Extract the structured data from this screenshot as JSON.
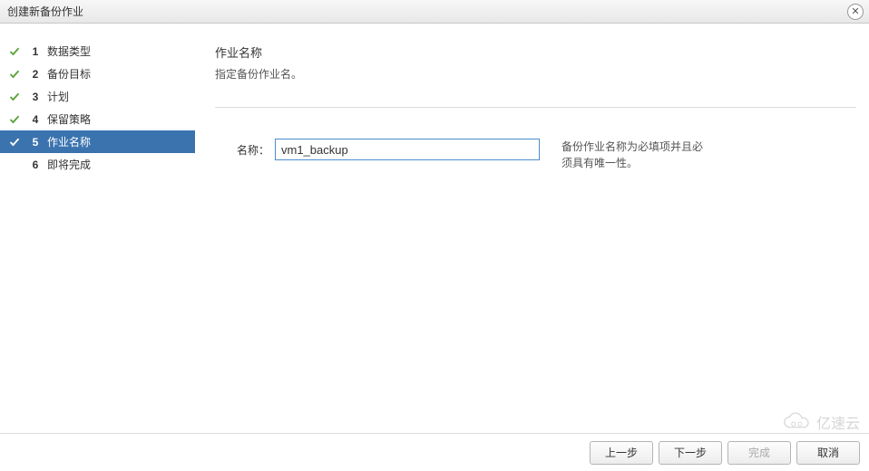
{
  "window": {
    "title": "创建新备份作业",
    "close_icon": "✕"
  },
  "sidebar": {
    "steps": [
      {
        "num": "1",
        "label": "数据类型",
        "done": true,
        "active": false
      },
      {
        "num": "2",
        "label": "备份目标",
        "done": true,
        "active": false
      },
      {
        "num": "3",
        "label": "计划",
        "done": true,
        "active": false
      },
      {
        "num": "4",
        "label": "保留策略",
        "done": true,
        "active": false
      },
      {
        "num": "5",
        "label": "作业名称",
        "done": true,
        "active": true
      },
      {
        "num": "6",
        "label": "即将完成",
        "done": false,
        "active": false
      }
    ]
  },
  "main": {
    "title": "作业名称",
    "description": "指定备份作业名。",
    "name_label": "名称：",
    "name_value": "vm1_backup",
    "help_line1": "备份作业名称为必填项并且必",
    "help_line2": "须具有唯一性。"
  },
  "footer": {
    "prev": "上一步",
    "next": "下一步",
    "finish": "完成",
    "cancel": "取消"
  },
  "watermark": {
    "text": "亿速云"
  }
}
